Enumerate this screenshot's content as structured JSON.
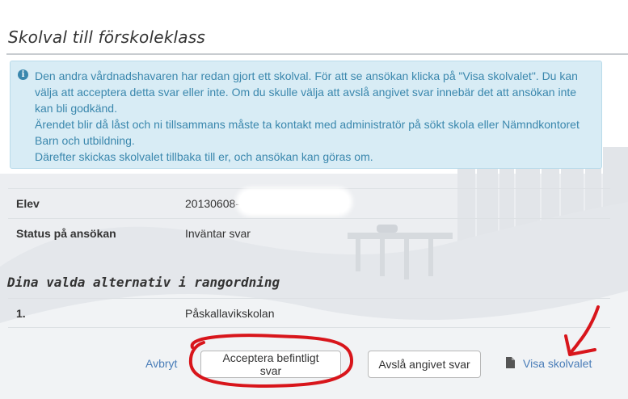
{
  "page": {
    "title": "Skolval till förskoleklass"
  },
  "info": {
    "icon": "info-circle-icon",
    "lines": [
      "Den andra vårdnadshavaren har redan gjort ett skolval. För att se ansökan klicka på \"Visa skolvalet\". Du kan",
      "välja att acceptera detta svar eller inte. Om du skulle välja att avslå angivet svar innebär det att ansökan inte",
      "kan bli godkänd.",
      "Ärendet blir då låst och ni tillsammans måste ta kontakt med administratör på sökt skola eller Nämndkontoret",
      "Barn och utbildning.",
      "Därefter skickas skolvalet tillbaka till er, och ansökan kan göras om."
    ]
  },
  "details": {
    "elev_label": "Elev",
    "elev_value": "20130608-",
    "status_label": "Status på ansökan",
    "status_value": "Inväntar svar"
  },
  "choices": {
    "title": "Dina valda alternativ i rangordning",
    "items": [
      {
        "rank": "1.",
        "school": "Påskallavikskolan"
      }
    ]
  },
  "actions": {
    "cancel_label": "Avbryt",
    "accept_label": "Acceptera befintligt svar",
    "reject_label": "Avslå angivet svar",
    "view_label": "Visa skolvalet",
    "view_icon": "document-icon"
  },
  "colors": {
    "info_bg": "#d8ecf5",
    "info_text": "#3a87ad",
    "link": "#4a7db8",
    "annotation": "#d8151b"
  }
}
